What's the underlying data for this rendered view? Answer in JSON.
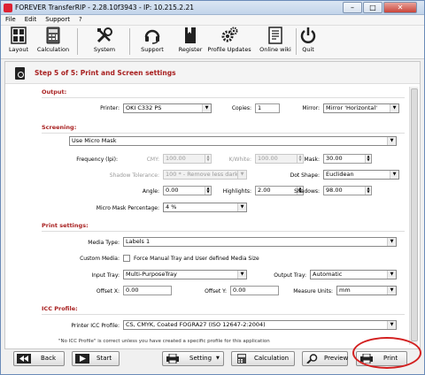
{
  "window": {
    "title": "FOREVER TransferRIP - 2.28.10f3943 - IP: 10.215.2.21",
    "min": "–",
    "max": "□",
    "close": "✕"
  },
  "menu": [
    "File",
    "Edit",
    "Support",
    "?"
  ],
  "toolbar": [
    {
      "label": "Layout",
      "icon": "layout-icon"
    },
    {
      "label": "Calculation",
      "icon": "calculator-icon"
    },
    {
      "label": "System",
      "icon": "tools-icon"
    },
    {
      "label": "Support",
      "icon": "headset-icon"
    },
    {
      "label": "Register",
      "icon": "register-icon"
    },
    {
      "label": "Profile Updates",
      "icon": "gears-icon"
    },
    {
      "label": "Online wiki",
      "icon": "wiki-icon"
    },
    {
      "label": "Quit",
      "icon": "power-icon"
    }
  ],
  "step_title": "Step 5 of 5: Print and Screen settings",
  "output": {
    "section": "Output:",
    "printer_label": "Printer:",
    "printer": "OKI C332 PS",
    "copies_label": "Copies:",
    "copies": "1",
    "mirror_label": "Mirror:",
    "mirror": "Mirror 'Horizontal'"
  },
  "screening": {
    "section": "Screening:",
    "mode": "Use Micro Mask",
    "frequency_label": "Frequency (lpi):",
    "cmy_label": "CMY:",
    "cmy": "100.00",
    "kwhite_label": "K/White:",
    "kwhite": "100.00",
    "mask_label": "Mask:",
    "mask": "30.00",
    "tolerance_label": "Shadow Tolerance:",
    "tolerance": "100 * - Remove less dark Co",
    "dot_label": "Dot Shape:",
    "dot": "Euclidean",
    "angle_label": "Angle:",
    "angle": "0.00",
    "highlights_label": "Highlights:",
    "highlights": "2.00",
    "shadows_label": "Shadows:",
    "shadows": "98.00",
    "micro_label": "Micro Mask Percentage:",
    "micro": "4 %"
  },
  "print": {
    "section": "Print settings:",
    "media_label": "Media Type:",
    "media": "Labels 1",
    "custom_label": "Custom Media:",
    "custom_cb": "Force Manual Tray and User defined Media Size",
    "input_label": "Input Tray:",
    "input": "Multi-PurposeTray",
    "output_label": "Output Tray:",
    "output": "Automatic",
    "offx_label": "Offset X:",
    "offx": "0.00",
    "offy_label": "Offset Y:",
    "offy": "0.00",
    "units_label": "Measure Units:",
    "units": "mm"
  },
  "icc": {
    "section": "ICC Profile:",
    "profile_label": "Printer ICC Profile:",
    "profile": "CS, CMYK, Coated FOGRA27 (ISO 12647-2:2004)",
    "note": "\"No ICC Profile\" is correct unless you have created a specific profile for this application"
  },
  "buttons": {
    "back": "Back",
    "start": "Start",
    "setting": "Setting",
    "calculation": "Calculation",
    "preview": "Preview",
    "print": "Print"
  },
  "colors": {
    "section": "#a82020",
    "highlight": "#d32020"
  }
}
